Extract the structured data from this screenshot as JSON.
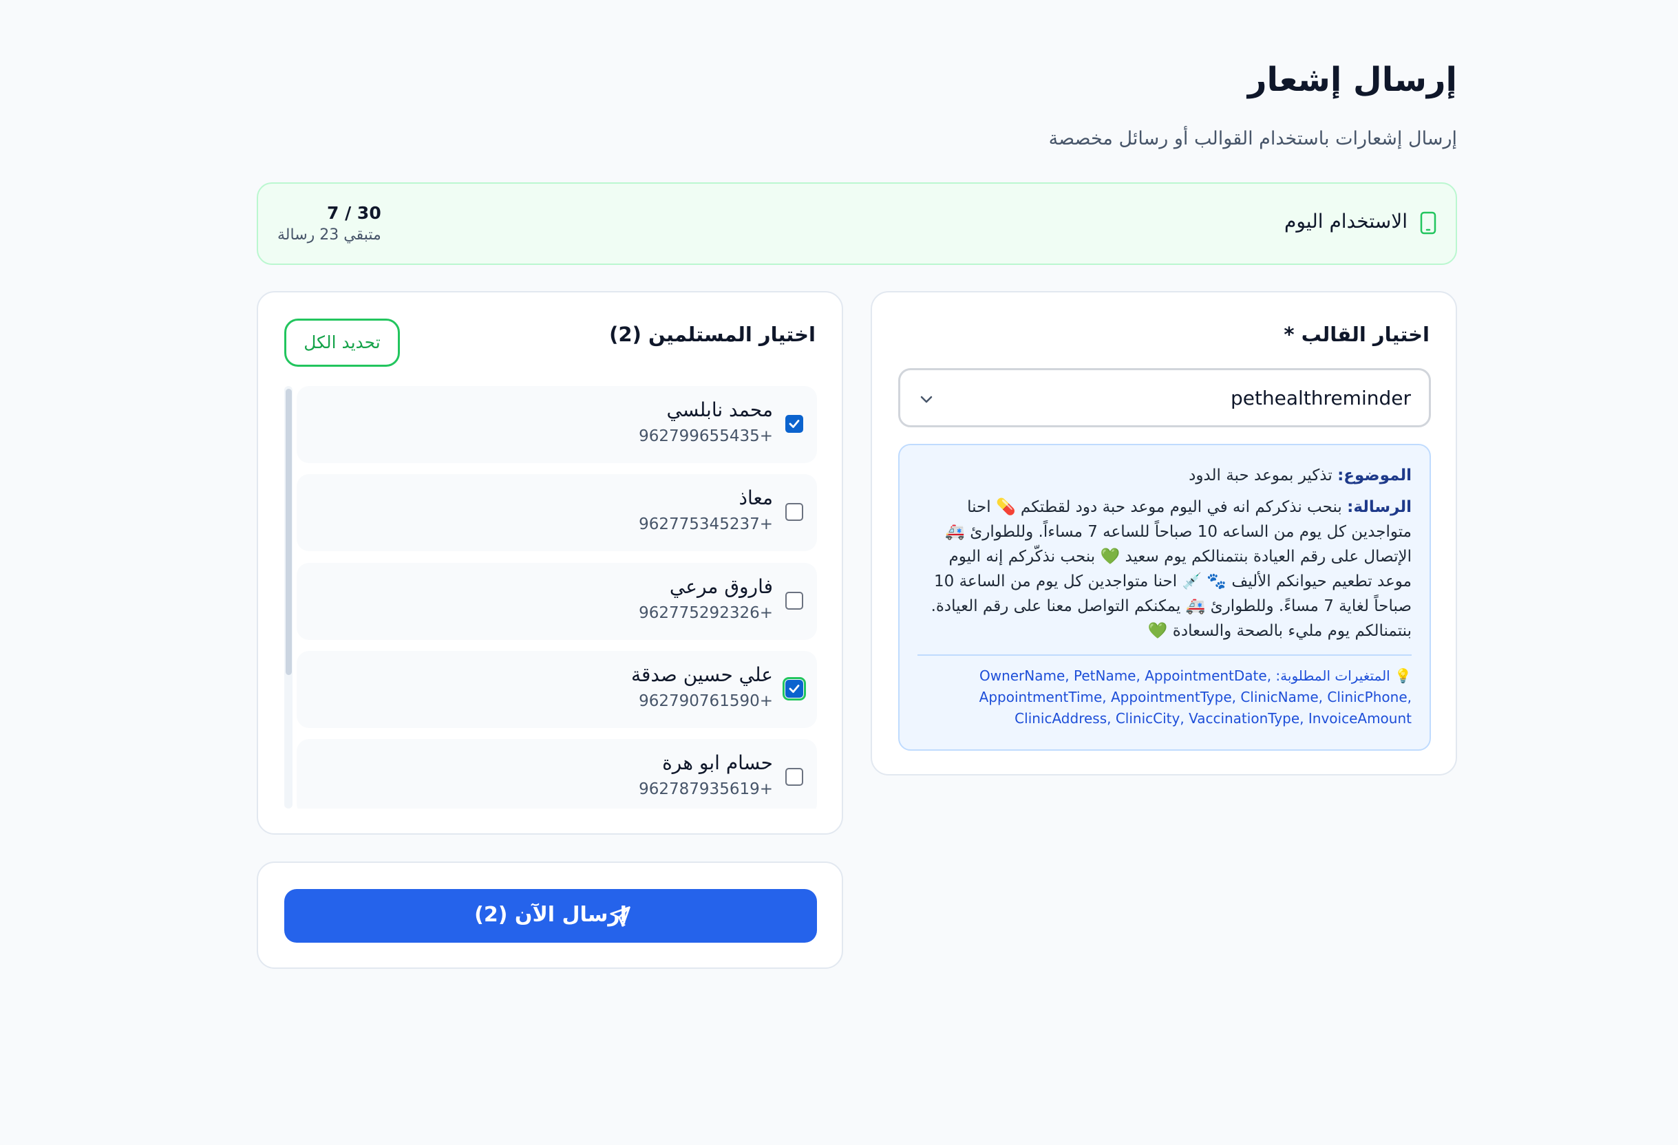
{
  "header": {
    "title": "إرسال إشعار",
    "subtitle": "إرسال إشعارات باستخدام القوالب أو رسائل مخصصة"
  },
  "usage": {
    "label": "الاستخدام اليوم",
    "count": "7 / 30",
    "remaining": "متبقي 23 رسالة",
    "used": 7,
    "limit": 30
  },
  "template": {
    "heading": "اختيار القالب *",
    "selected": "pethealthreminder",
    "subject_key": "الموضوع:",
    "subject": "تذكير بموعد حبة الدود",
    "message_key": "الرسالة:",
    "message": "بنحب نذكركم انه في اليوم موعد حبة دود لقطتكم 💊 احنا متواجدين كل يوم من الساعه 10 صباحاً للساعه 7 مساءاً. وللطوارئ 🚑 الإتصال على رقم العيادة بنتمنالكم يوم سعيد 💚 بنحب نذكّركم إنه اليوم موعد تطعيم حيوانكم الأليف 🐾 💉 احنا متواجدين كل يوم من الساعة 10 صباحاً لغاية 7 مساءً. وللطوارئ 🚑 يمكنكم التواصل معنا على رقم العيادة. بنتمنالكم يوم مليء بالصحة والسعادة 💚",
    "vars_key": "💡 المتغيرات المطلوبة:",
    "vars": "OwnerName, PetName, AppointmentDate, AppointmentTime, AppointmentType, ClinicName, ClinicPhone, ClinicAddress, ClinicCity, VaccinationType, InvoiceAmount"
  },
  "recipients": {
    "heading": "اختيار المستلمين (2)",
    "select_all": "تحديد الكل",
    "items": [
      {
        "name": "محمد نابلسي",
        "phone": "962799655435+",
        "checked": true
      },
      {
        "name": "معاذ",
        "phone": "962775345237+",
        "checked": false
      },
      {
        "name": "فاروق مرعي",
        "phone": "962775292326+",
        "checked": false
      },
      {
        "name": "علي حسين صدقة",
        "phone": "962790761590+",
        "checked": true
      },
      {
        "name": "حسام ابو هرة",
        "phone": "962787935619+",
        "checked": false
      }
    ]
  },
  "send": {
    "label": "إرسال الآن (2)"
  },
  "colors": {
    "primary": "#2563eb",
    "success": "#22c55e",
    "checkbox": "#0b63ce"
  }
}
